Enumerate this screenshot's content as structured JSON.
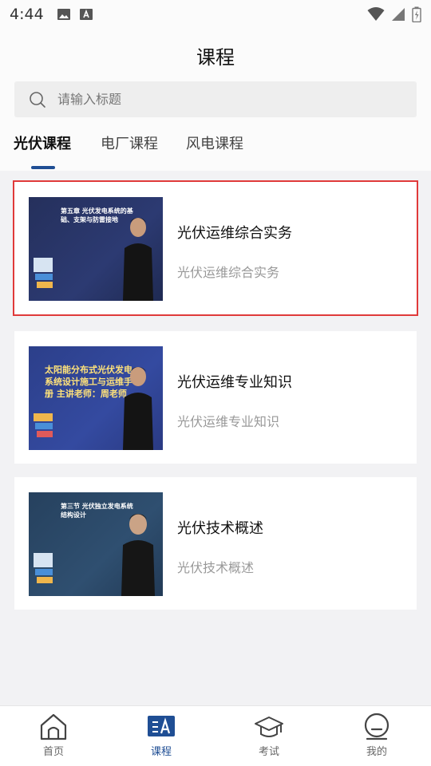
{
  "status_bar": {
    "time": "4:44"
  },
  "page_title": "课程",
  "search": {
    "placeholder": "请输入标题"
  },
  "tabs": [
    {
      "label": "光伏课程",
      "active": true
    },
    {
      "label": "电厂课程",
      "active": false
    },
    {
      "label": "风电课程",
      "active": false
    }
  ],
  "courses": [
    {
      "thumb_text": "第五章 光伏发电系统的基础、支架与防雷接地",
      "title": "光伏运维综合实务",
      "subtitle": "光伏运维综合实务",
      "selected": true
    },
    {
      "thumb_text": "太阳能分布式光伏发电系统设计施工与运维手册 主讲老师：周老师",
      "title": "光伏运维专业知识",
      "subtitle": "光伏运维专业知识",
      "selected": false
    },
    {
      "thumb_text": "第三节 光伏独立发电系统结构设计",
      "title": "光伏技术概述",
      "subtitle": "光伏技术概述",
      "selected": false
    }
  ],
  "bottom_nav": [
    {
      "label": "首页",
      "icon": "home-icon",
      "active": false
    },
    {
      "label": "课程",
      "icon": "course-icon",
      "active": true
    },
    {
      "label": "考试",
      "icon": "graduation-cap-icon",
      "active": false
    },
    {
      "label": "我的",
      "icon": "profile-icon",
      "active": false
    }
  ],
  "colors": {
    "accent": "#1f4e94",
    "selection_border": "#e03a3a"
  }
}
